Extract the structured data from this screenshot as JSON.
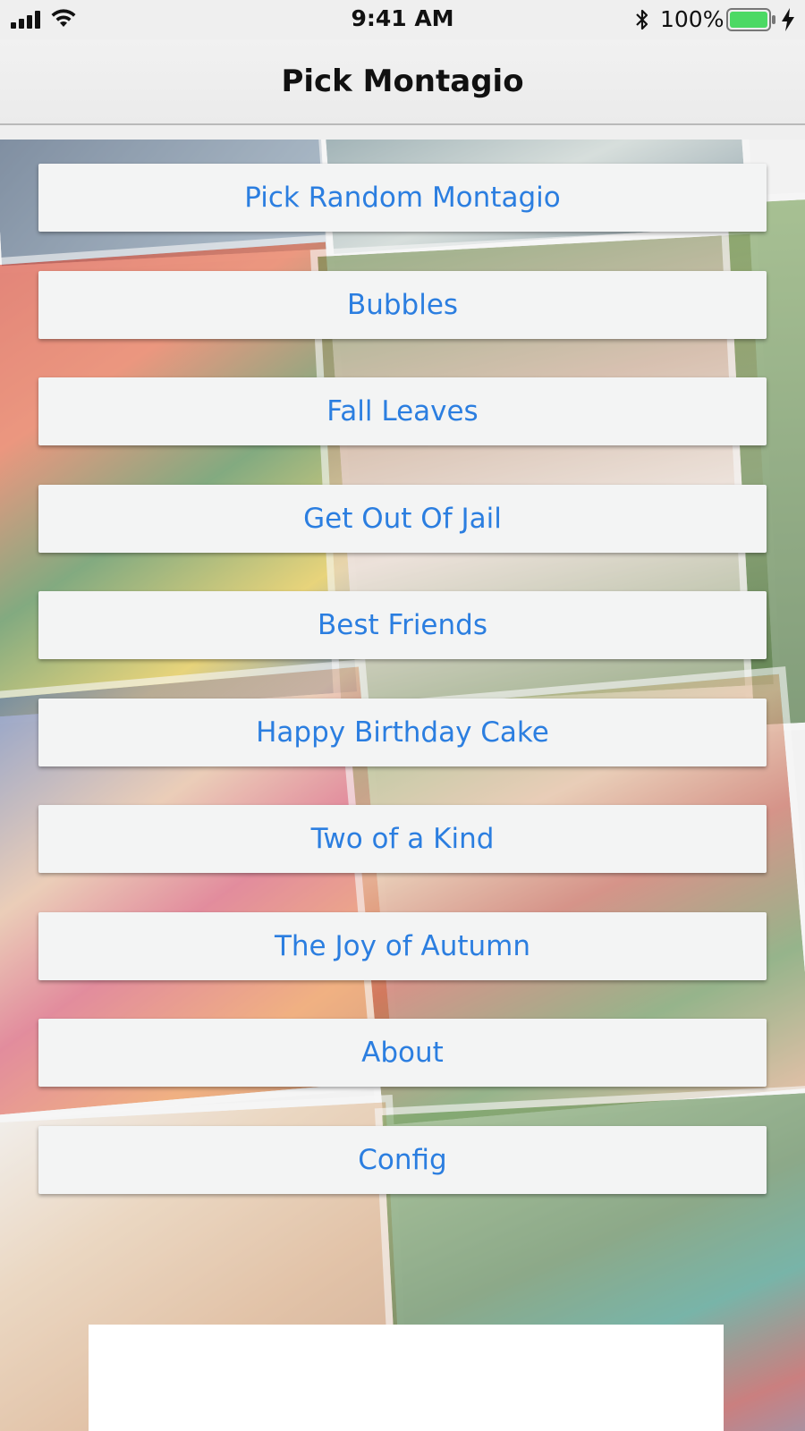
{
  "status_bar": {
    "time": "9:41 AM",
    "battery_percent": "100%",
    "icons": [
      "cellular-signal-icon",
      "wifi-icon",
      "bluetooth-icon",
      "battery-icon",
      "charging-bolt-icon"
    ]
  },
  "nav": {
    "title": "Pick Montagio"
  },
  "menu": {
    "items": [
      {
        "label": "Pick Random Montagio"
      },
      {
        "label": "Bubbles"
      },
      {
        "label": "Fall Leaves"
      },
      {
        "label": "Get Out Of Jail"
      },
      {
        "label": "Best Friends"
      },
      {
        "label": "Happy Birthday Cake"
      },
      {
        "label": "Two of a Kind"
      },
      {
        "label": "The Joy of Autumn"
      },
      {
        "label": "About"
      },
      {
        "label": "Config"
      }
    ]
  },
  "colors": {
    "button_text": "#2b7ee0",
    "button_background": "#f3f4f4",
    "battery_fill": "#4cd964"
  }
}
